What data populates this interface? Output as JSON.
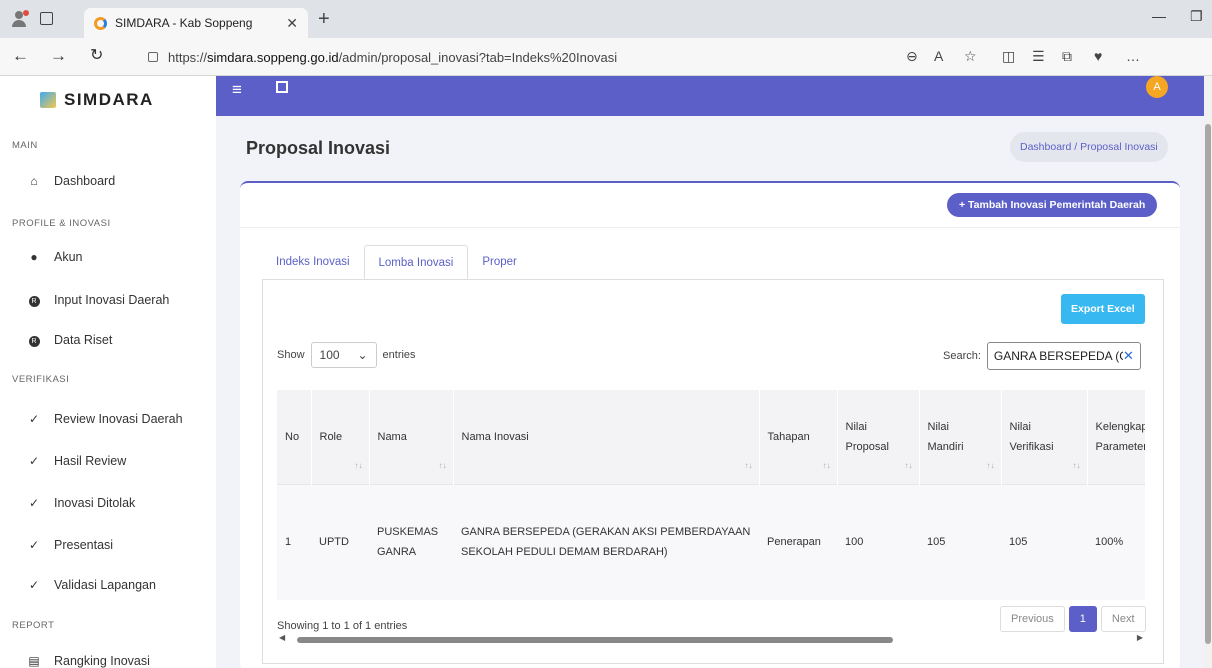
{
  "browser": {
    "tab_title": "SIMDARA - Kab Soppeng",
    "url_prefix": "https://",
    "url_domain": "simdara.soppeng.go.id",
    "url_path": "/admin/proposal_inovasi?tab=Indeks%20Inovasi"
  },
  "sidebar": {
    "brand": "SIMDARA",
    "sections": {
      "main": "MAIN",
      "profile": "PROFILE & INOVASI",
      "verifikasi": "VERIFIKASI",
      "report": "REPORT"
    },
    "items": {
      "dashboard": "Dashboard",
      "akun": "Akun",
      "input_inovasi": "Input Inovasi Daerah",
      "data_riset": "Data Riset",
      "review_inovasi": "Review Inovasi Daerah",
      "hasil_review": "Hasil Review",
      "inovasi_ditolak": "Inovasi Ditolak",
      "presentasi": "Presentasi",
      "validasi": "Validasi Lapangan",
      "rangking": "Rangking Inovasi"
    }
  },
  "header": {
    "avatar_letter": "A"
  },
  "page": {
    "title": "Proposal Inovasi",
    "breadcrumb": "Dashboard  /  Proposal Inovasi",
    "add_button": "+ Tambah Inovasi Pemerintah Daerah",
    "tabs": [
      "Indeks Inovasi",
      "Lomba Inovasi",
      "Proper"
    ],
    "active_tab": "Lomba Inovasi",
    "export_button": "Export Excel",
    "show_label": "Show",
    "entries_value": "100",
    "entries_label": "entries",
    "search_label": "Search:",
    "search_value": "GANRA BERSEPEDA (GI"
  },
  "table": {
    "headers": [
      "No",
      "Role",
      "Nama",
      "Nama Inovasi",
      "Tahapan",
      "Nilai Proposal",
      "Nilai Mandiri",
      "Nilai Verifikasi",
      "Kelengkap Parameter"
    ],
    "rows": [
      [
        "1",
        "UPTD",
        "PUSKEMAS GANRA",
        "GANRA BERSEPEDA (GERAKAN AKSI PEMBERDAYAAN SEKOLAH PEDULI DEMAM BERDARAH)",
        "Penerapan",
        "100",
        "105",
        "105",
        "100%"
      ]
    ]
  },
  "footer": {
    "info": "Showing 1 to 1 of 1 entries",
    "prev": "Previous",
    "page": "1",
    "next": "Next"
  }
}
